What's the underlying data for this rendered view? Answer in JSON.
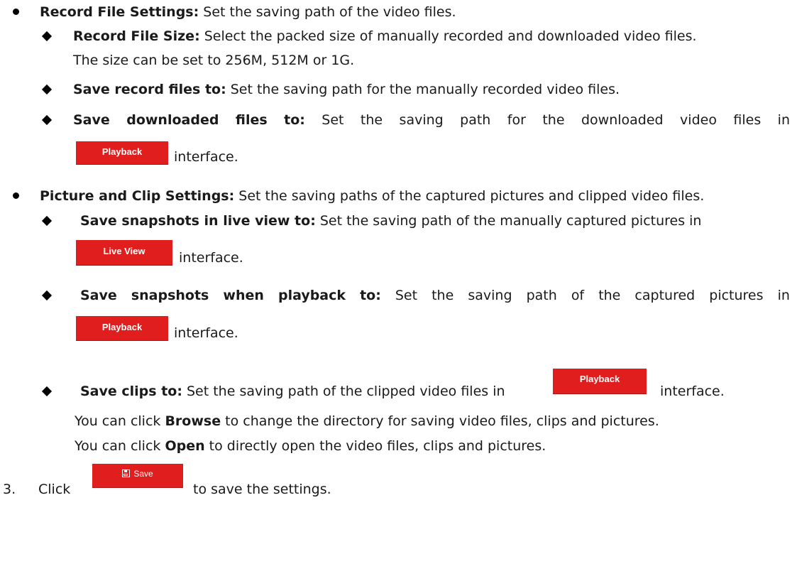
{
  "record_settings": {
    "heading": "Record File Settings:",
    "desc": " Set the saving path of the video files.",
    "items": [
      {
        "label": "Record File Size:",
        "text": " Select the packed size of manually recorded and downloaded video files.",
        "text2": "The size can be set to 256M, 512M or 1G."
      },
      {
        "label": "Save record files to:",
        "text": " Set the saving path for the manually recorded video files."
      },
      {
        "label": "Save downloaded files to:",
        "words": [
          "Set",
          "the",
          "saving",
          "path",
          "for",
          "the",
          "downloaded",
          "video",
          "files",
          "in"
        ],
        "button": "Playback",
        "suffix": "interface."
      }
    ]
  },
  "picture_settings": {
    "heading": "Picture and Clip Settings:",
    "desc": " Set the saving paths of the captured pictures and clipped video files.",
    "items": [
      {
        "label": "Save snapshots in live view to:",
        "text": " Set the saving path of the manually captured pictures in",
        "button": "Live View",
        "suffix": "interface."
      },
      {
        "label": "Save snapshots when playback to:",
        "words": [
          "Set",
          "the",
          "saving",
          "path",
          "of",
          "the",
          "captured",
          "pictures",
          "in"
        ],
        "button": "Playback",
        "suffix": "interface."
      },
      {
        "label": "Save clips to:",
        "text": " Set the saving path of the clipped video files in",
        "button": "Playback",
        "suffix": "interface."
      }
    ]
  },
  "notes": {
    "browse_pre": "You can click ",
    "browse_word": "Browse",
    "browse_post": " to change the directory for saving video files, clips and pictures.",
    "open_pre": "You can click ",
    "open_word": "Open",
    "open_post": " to directly open the video files, clips and pictures."
  },
  "step": {
    "number": "3.",
    "click": "Click",
    "button": "Save",
    "suffix": "to save the settings."
  }
}
